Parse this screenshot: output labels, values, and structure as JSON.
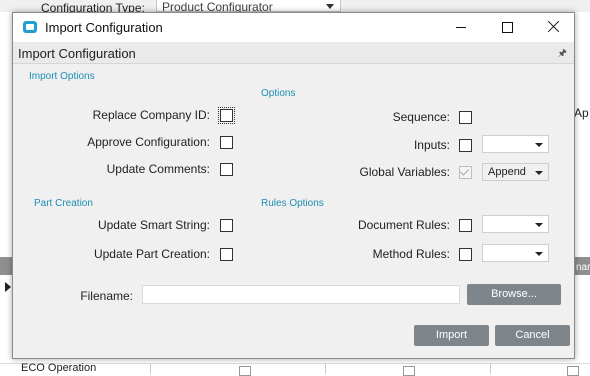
{
  "background": {
    "config_type_label": "Configuration Type:",
    "config_type_value": "Product Configurator",
    "right_cut_text": "Ap",
    "grid_header_right": "nar",
    "eco_operation": "ECO Operation"
  },
  "window": {
    "title": "Import Configuration",
    "icon": "app-icon",
    "controls": {
      "minimize": "minimize-icon",
      "maximize": "maximize-icon",
      "close": "close-icon"
    }
  },
  "panel": {
    "title": "Import Configuration",
    "pin": "pin-icon"
  },
  "sections": {
    "import_options": "Import Options",
    "options": "Options",
    "part_creation": "Part Creation",
    "rules_options": "Rules Options"
  },
  "fields": {
    "replace_company_id": {
      "label": "Replace Company ID:",
      "checked": false
    },
    "approve_configuration": {
      "label": "Approve Configuration:",
      "checked": false
    },
    "update_comments": {
      "label": "Update Comments:",
      "checked": false
    },
    "sequence": {
      "label": "Sequence:",
      "checked": false
    },
    "inputs": {
      "label": "Inputs:",
      "checked": false,
      "dropdown": ""
    },
    "global_variables": {
      "label": "Global Variables:",
      "checked": true,
      "disabled": true,
      "dropdown": "Append"
    },
    "update_smart_string": {
      "label": "Update Smart String:",
      "checked": false
    },
    "update_part_creation": {
      "label": "Update Part Creation:",
      "checked": false
    },
    "document_rules": {
      "label": "Document Rules:",
      "checked": false,
      "dropdown": ""
    },
    "method_rules": {
      "label": "Method Rules:",
      "checked": false,
      "dropdown": ""
    },
    "filename": {
      "label": "Filename:",
      "value": "",
      "placeholder": ""
    }
  },
  "buttons": {
    "browse": "Browse...",
    "import": "Import",
    "cancel": "Cancel"
  },
  "colors": {
    "section_header": "#1a8fb5",
    "button_bg": "#7e868c",
    "dialog_bg": "#f0f0f0"
  }
}
